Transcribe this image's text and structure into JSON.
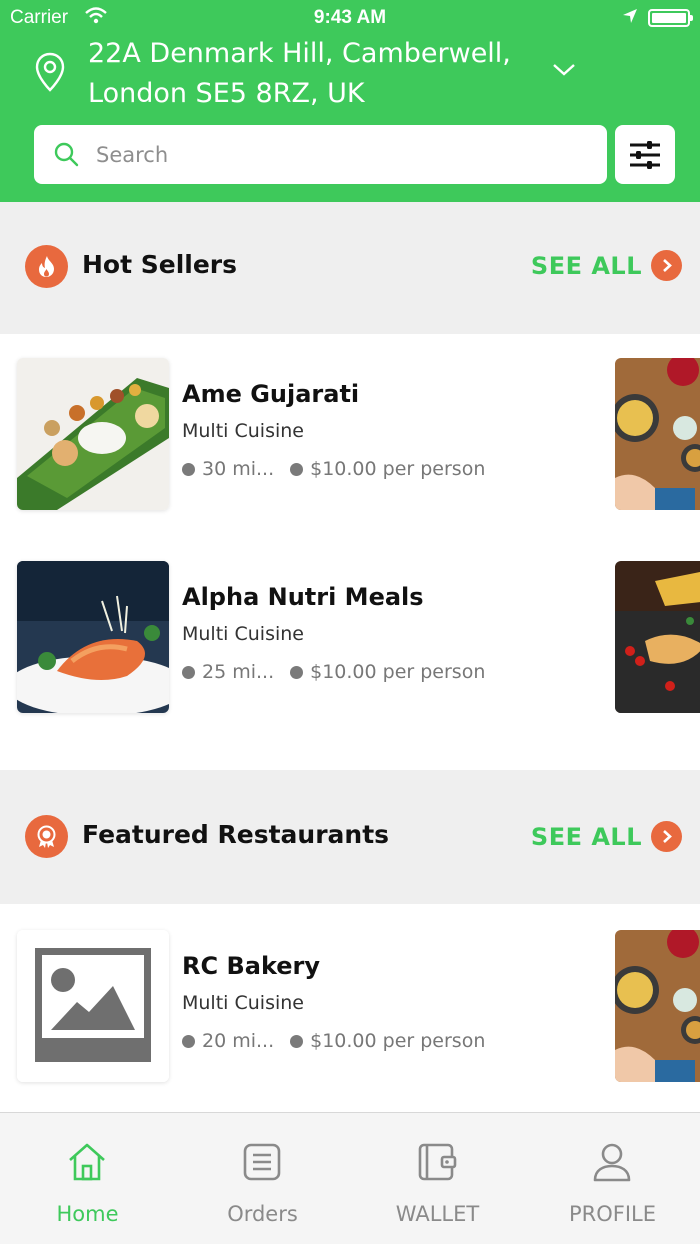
{
  "status_bar": {
    "carrier": "Carrier",
    "time": "9:43 AM"
  },
  "header": {
    "address_line1": "22A Denmark Hill,  Camberwell,",
    "address_line2": "London SE5 8RZ,  UK",
    "search_placeholder": "Search"
  },
  "sections": [
    {
      "title": "Hot Sellers",
      "see_all": "SEE ALL",
      "icon": "flame-icon",
      "items": [
        {
          "name": "Ame Gujarati",
          "cuisine": "Multi Cuisine",
          "time": "30 mi...",
          "price": "$10.00 per person"
        },
        {
          "name": "Alpha Nutri Meals",
          "cuisine": "Multi Cuisine",
          "time": "25 mi...",
          "price": "$10.00 per person"
        }
      ]
    },
    {
      "title": "Featured Restaurants",
      "see_all": "SEE ALL",
      "icon": "award-badge-icon",
      "items": [
        {
          "name": "RC Bakery",
          "cuisine": "Multi Cuisine",
          "time": "20 mi...",
          "price": "$10.00 per person"
        }
      ]
    }
  ],
  "tabs": [
    {
      "label": "Home",
      "icon": "home-icon",
      "active": true
    },
    {
      "label": "Orders",
      "icon": "orders-list-icon",
      "active": false
    },
    {
      "label": "WALLET",
      "icon": "wallet-icon",
      "active": false
    },
    {
      "label": "PROFILE",
      "icon": "profile-icon",
      "active": false
    }
  ],
  "colors": {
    "brand_green": "#3ec95b",
    "accent_orange": "#e8693e",
    "section_bg": "#efefef"
  }
}
